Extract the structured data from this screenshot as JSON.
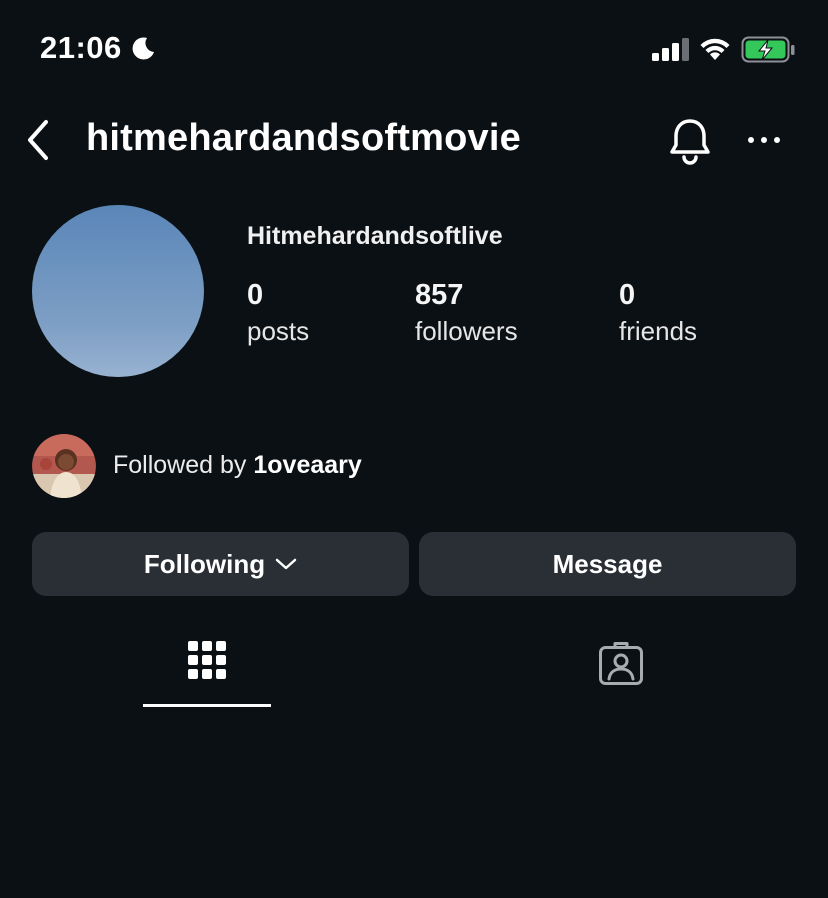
{
  "status_bar": {
    "time": "21:06",
    "icons": [
      "moon-icon",
      "signal-icon",
      "wifi-icon",
      "battery-charging-icon"
    ]
  },
  "header": {
    "username": "hitmehardandsoftmovie",
    "icons": [
      "back-icon",
      "bell-icon",
      "more-icon"
    ]
  },
  "profile": {
    "display_name": "Hitmehardandsoftlive",
    "stats": [
      {
        "value": "0",
        "label": "posts"
      },
      {
        "value": "857",
        "label": "followers"
      },
      {
        "value": "0",
        "label": "friends"
      }
    ]
  },
  "followed_by": {
    "prefix": "Followed by",
    "username": "1oveaary"
  },
  "actions": {
    "following_label": "Following",
    "message_label": "Message"
  },
  "tabs": {
    "items": [
      "grid-icon",
      "tagged-icon"
    ],
    "active": "grid-icon"
  },
  "colors": {
    "background": "#0b1014",
    "button": "#2a2e35",
    "battery": "#34c759"
  }
}
